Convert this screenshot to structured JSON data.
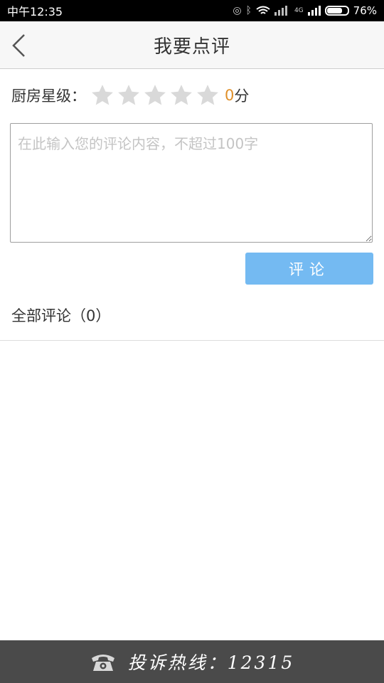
{
  "status_bar": {
    "time": "中午12:35",
    "network_label": "4G",
    "battery_percent": "76%",
    "battery_level": 0.76
  },
  "header": {
    "title": "我要点评"
  },
  "rating": {
    "label": "厨房星级：",
    "stars_total": 5,
    "stars_filled": 0,
    "score": "0",
    "unit": "分"
  },
  "comment": {
    "placeholder": "在此输入您的评论内容，不超过100字",
    "value": "",
    "submit_label": "评论"
  },
  "comments_list": {
    "heading": "全部评论（0）",
    "items": []
  },
  "footer": {
    "hotline_text": "投诉热线：12315"
  },
  "icons": {
    "back": "chevron-left-icon",
    "star": "star-icon",
    "phone": "phone-icon"
  },
  "colors": {
    "accent_button": "#74baf2",
    "score": "#e0902a",
    "star_empty": "#d9d9d9",
    "footer_bg": "#4a4a4a"
  }
}
